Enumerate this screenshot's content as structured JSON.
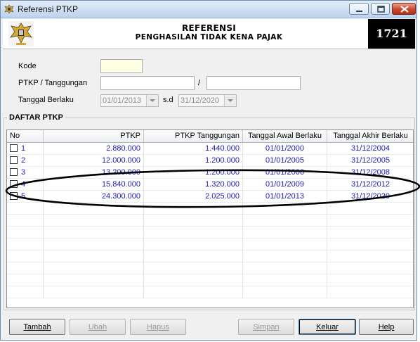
{
  "window": {
    "title": "Referensi PTKP"
  },
  "header": {
    "title": "REFERENSI",
    "subtitle": "PENGHASILAN TIDAK KENA PAJAK",
    "code": "1721"
  },
  "form": {
    "kode_label": "Kode",
    "kode_value": "",
    "ptkp_label": "PTKP / Tanggungan",
    "ptkp_value": "",
    "separator": "/",
    "tanggungan_value": "",
    "tanggal_label": "Tanggal Berlaku",
    "tanggal_from": "01/01/2013",
    "sd_label": "s.d",
    "tanggal_to": "31/12/2020"
  },
  "list": {
    "title": "DAFTAR PTKP",
    "columns": [
      "No",
      "PTKP",
      "PTKP Tanggungan",
      "Tanggal Awal Berlaku",
      "Tanggal Akhir Berlaku"
    ],
    "rows": [
      {
        "no": "1",
        "ptkp": "2.880.000",
        "tanggungan": "1.440.000",
        "awal": "01/01/2000",
        "akhir": "31/12/2004"
      },
      {
        "no": "2",
        "ptkp": "12.000.000",
        "tanggungan": "1.200.000",
        "awal": "01/01/2005",
        "akhir": "31/12/2005"
      },
      {
        "no": "3",
        "ptkp": "13.200.000",
        "tanggungan": "1.200.000",
        "awal": "01/01/2006",
        "akhir": "31/12/2008"
      },
      {
        "no": "4",
        "ptkp": "15.840.000",
        "tanggungan": "1.320.000",
        "awal": "01/01/2009",
        "akhir": "31/12/2012"
      },
      {
        "no": "5",
        "ptkp": "24.300.000",
        "tanggungan": "2.025.000",
        "awal": "01/01/2013",
        "akhir": "31/12/2020"
      }
    ]
  },
  "buttons": {
    "tambah": "Tambah",
    "ubah": "Ubah",
    "hapus": "Hapus",
    "simpan": "Simpan",
    "keluar": "Keluar",
    "help": "Help"
  },
  "colors": {
    "accent_text": "#1a1ab8",
    "header_code_bg": "#000000"
  },
  "icons": {
    "title": "garuda-emblem-icon",
    "logo": "garuda-emblem-icon"
  }
}
